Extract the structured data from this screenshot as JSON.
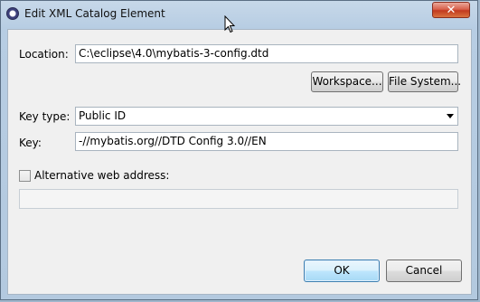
{
  "window": {
    "title": "Edit XML Catalog Element",
    "close_glyph": "✕"
  },
  "location": {
    "label": "Location:",
    "value": "C:\\eclipse\\4.0\\mybatis-3-config.dtd"
  },
  "buttons": {
    "workspace": "Workspace...",
    "file_system": "File System...",
    "ok": "OK",
    "cancel": "Cancel"
  },
  "key_type": {
    "label": "Key type:",
    "selected": "Public ID"
  },
  "key": {
    "label": "Key:",
    "value": "-//mybatis.org//DTD Config 3.0//EN"
  },
  "alternative": {
    "label": "Alternative web address:",
    "checked": false,
    "value": ""
  },
  "icons": [
    "app-icon",
    "close-icon",
    "chevron-down-icon",
    "mouse-cursor-icon"
  ]
}
